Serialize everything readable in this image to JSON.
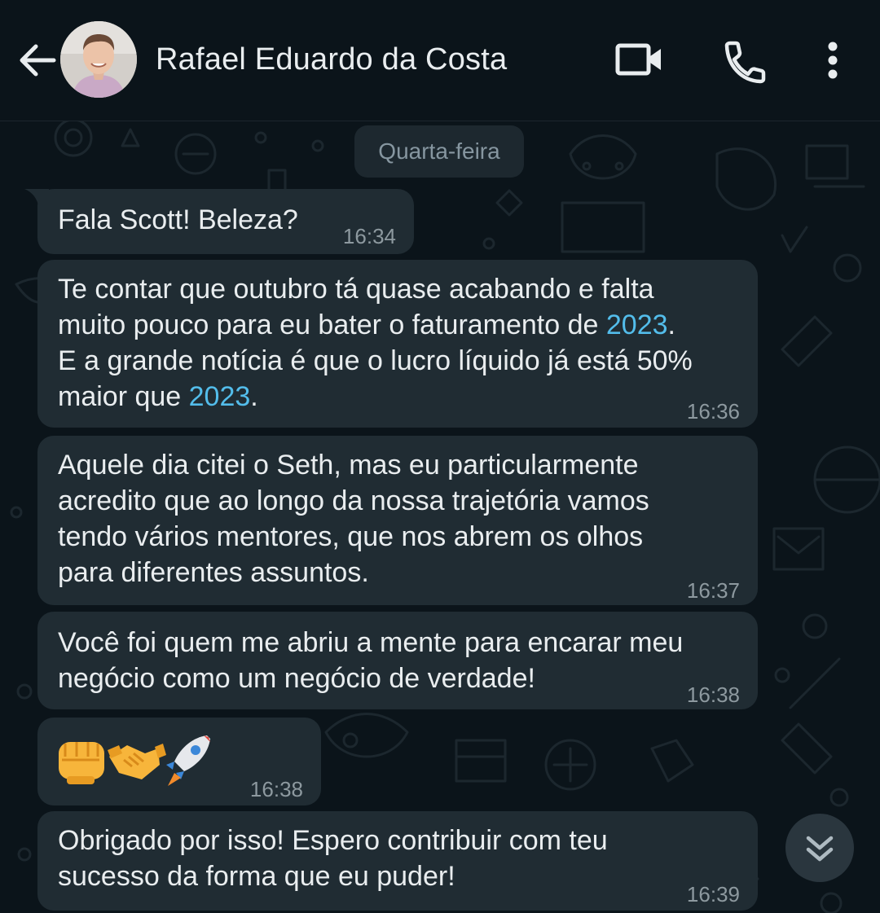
{
  "header": {
    "contact_name": "Rafael Eduardo da Costa",
    "icons": [
      "back-arrow-icon",
      "video-call-icon",
      "voice-call-icon",
      "more-options-icon"
    ]
  },
  "chat": {
    "day_label": "Quarta-feira",
    "messages": [
      {
        "time": "16:34",
        "lines": [
          "Fala Scott! Beleza?"
        ]
      },
      {
        "time": "16:36",
        "line1": "Te contar que outubro tá quase acabando e falta",
        "line2_pre": "muito pouco para eu bater o faturamento de ",
        "line2_link": "2023",
        "line2_post": ".",
        "line3": "E a grande notícia é que o lucro líquido já está 50%",
        "line4_pre": "maior que ",
        "line4_link": "2023",
        "line4_post": "."
      },
      {
        "time": "16:37",
        "lines": [
          "Aquele dia citei o Seth, mas eu particularmente",
          "acredito que ao longo da nossa trajetória vamos",
          "tendo vários mentores, que nos abrem os olhos",
          "para diferentes assuntos."
        ]
      },
      {
        "time": "16:38",
        "lines": [
          "Você foi quem me abriu a mente para encarar meu",
          "negócio como um negócio de verdade!"
        ]
      },
      {
        "time": "16:38",
        "emojis": [
          "fist-emoji",
          "handshake-emoji",
          "rocket-emoji"
        ]
      },
      {
        "time": "16:39",
        "lines": [
          "Obrigado por isso! Espero contribuir com teu",
          "sucesso da forma que eu puder!"
        ]
      }
    ]
  },
  "colors": {
    "background": "#0b141a",
    "bubble": "#202c33",
    "link": "#53bdeb",
    "timestamp": "#8d999f"
  }
}
